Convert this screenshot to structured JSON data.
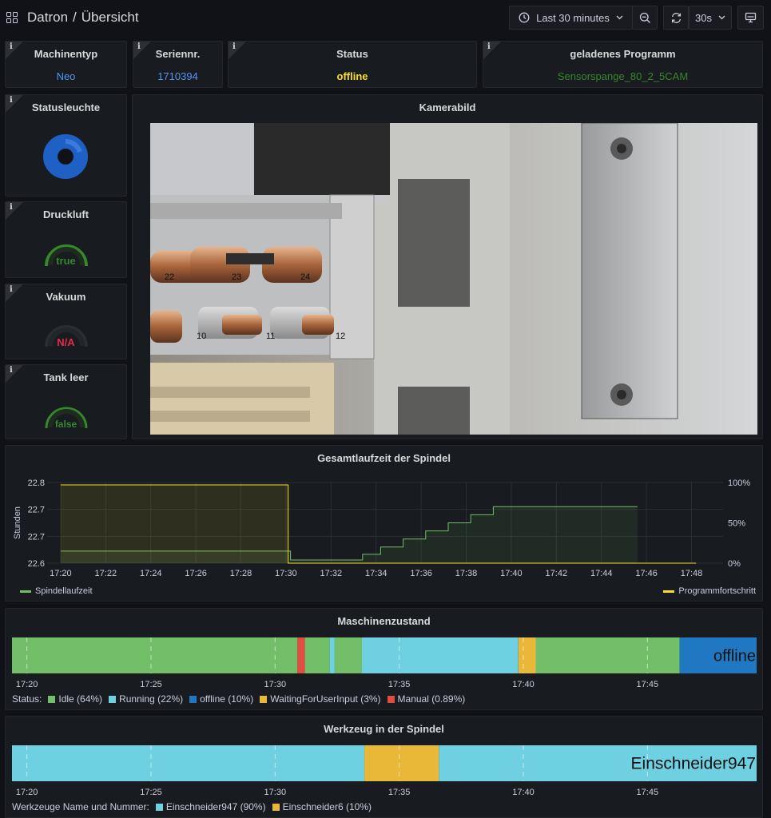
{
  "header": {
    "app": "Datron",
    "separator": "/",
    "page": "Übersicht",
    "time_range": "Last 30 minutes",
    "refresh": "30s"
  },
  "stats": {
    "maschinentyp": {
      "title": "Machinentyp",
      "value": "Neo",
      "color": "#5794f2"
    },
    "seriennr": {
      "title": "Seriennr.",
      "value": "1710394",
      "color": "#5794f2"
    },
    "status": {
      "title": "Status",
      "value": "offline",
      "color": "#fade2a"
    },
    "programm": {
      "title": "geladenes Programm",
      "value": "Sensorspange_80_2_5CAM",
      "color": "#37872d"
    }
  },
  "statusleuchte": {
    "title": "Statusleuchte",
    "color": "#1f60c4"
  },
  "gauges": {
    "druckluft": {
      "title": "Druckluft",
      "value": "true",
      "color": "#37872d"
    },
    "vakuum": {
      "title": "Vakuum",
      "value": "N/A",
      "color": "#e02f44"
    },
    "tank": {
      "title": "Tank leer",
      "value": "false",
      "color": "#37872d"
    }
  },
  "kamera": {
    "title": "Kamerabild",
    "labels": [
      "22",
      "23",
      "24",
      "10",
      "11",
      "12"
    ]
  },
  "chart_data": [
    {
      "type": "line",
      "title": "Gesamtlaufzeit der Spindel",
      "ylabel": "Stunden",
      "y_ticks": [
        "22.6",
        "22.7",
        "22.7",
        "22.8"
      ],
      "y_right_ticks": [
        "0%",
        "50%",
        "100%"
      ],
      "x_ticks": [
        "17:20",
        "17:22",
        "17:24",
        "17:26",
        "17:28",
        "17:30",
        "17:32",
        "17:34",
        "17:36",
        "17:38",
        "17:40",
        "17:42",
        "17:44",
        "17:46",
        "17:48"
      ],
      "series": [
        {
          "name": "Spindellaufzeit",
          "color": "#73bf69",
          "axis": "left",
          "x": [
            "17:20",
            "17:30.2",
            "17:30.2",
            "17:33.4",
            "17:33.4",
            "17:34.2",
            "17:34.2",
            "17:35.2",
            "17:35.2",
            "17:36.2",
            "17:36.2",
            "17:37.2",
            "17:37.2",
            "17:38.2",
            "17:38.2",
            "17:39.2",
            "17:39.2",
            "17:45.6"
          ],
          "y": [
            22.615,
            22.615,
            22.604,
            22.604,
            22.611,
            22.611,
            22.62,
            22.62,
            22.63,
            22.63,
            22.64,
            22.64,
            22.65,
            22.65,
            22.66,
            22.66,
            22.67,
            22.67
          ]
        },
        {
          "name": "Programmfortschritt",
          "color": "#fade2a",
          "axis": "right",
          "unit": "%",
          "x": [
            "17:20",
            "17:30.1",
            "17:30.1",
            "17:48.2"
          ],
          "y": [
            97,
            97,
            0,
            0
          ]
        }
      ]
    },
    {
      "type": "timeline",
      "title": "Maschinenzustand",
      "x_ticks": [
        "17:20",
        "17:25",
        "17:30",
        "17:35",
        "17:40",
        "17:45"
      ],
      "range": [
        "17:19.4",
        "17:49.4"
      ],
      "current_value": "offline",
      "segments": [
        {
          "state": "Idle",
          "from": "17:19.4",
          "to": "17:30.9"
        },
        {
          "state": "Manual",
          "from": "17:30.9",
          "to": "17:31.2"
        },
        {
          "state": "Idle",
          "from": "17:31.2",
          "to": "17:32.2"
        },
        {
          "state": "Running",
          "from": "17:32.2",
          "to": "17:32.4"
        },
        {
          "state": "Idle",
          "from": "17:32.4",
          "to": "17:33.5"
        },
        {
          "state": "Running",
          "from": "17:33.5",
          "to": "17:39.8"
        },
        {
          "state": "WaitingForUserInput",
          "from": "17:39.8",
          "to": "17:40.5"
        },
        {
          "state": "Idle",
          "from": "17:40.5",
          "to": "17:46.3"
        },
        {
          "state": "offline",
          "from": "17:46.3",
          "to": "17:49.4"
        }
      ],
      "legend_title": "Status:",
      "legend": [
        {
          "name": "Idle",
          "pct": "(64%)",
          "color": "#73bf69"
        },
        {
          "name": "Running",
          "pct": "(22%)",
          "color": "#6ed0e0"
        },
        {
          "name": "offline",
          "pct": "(10%)",
          "color": "#1f78c1"
        },
        {
          "name": "WaitingForUserInput",
          "pct": "(3%)",
          "color": "#eab839"
        },
        {
          "name": "Manual",
          "pct": "(0.89%)",
          "color": "#e24d42"
        }
      ]
    },
    {
      "type": "timeline",
      "title": "Werkzeug in der Spindel",
      "x_ticks": [
        "17:20",
        "17:25",
        "17:30",
        "17:35",
        "17:40",
        "17:45"
      ],
      "range": [
        "17:19.4",
        "17:49.4"
      ],
      "current_value": "Einschneider947",
      "segments": [
        {
          "state": "Einschneider947",
          "from": "17:19.4",
          "to": "17:33.6"
        },
        {
          "state": "Einschneider6",
          "from": "17:33.6",
          "to": "17:36.6"
        },
        {
          "state": "Einschneider947",
          "from": "17:36.6",
          "to": "17:49.4"
        }
      ],
      "legend_title": "Werkzeuge Name und Nummer:",
      "legend": [
        {
          "name": "Einschneider947",
          "pct": "(90%)",
          "color": "#6ed0e0"
        },
        {
          "name": "Einschneider6",
          "pct": "(10%)",
          "color": "#eab839"
        }
      ]
    }
  ]
}
